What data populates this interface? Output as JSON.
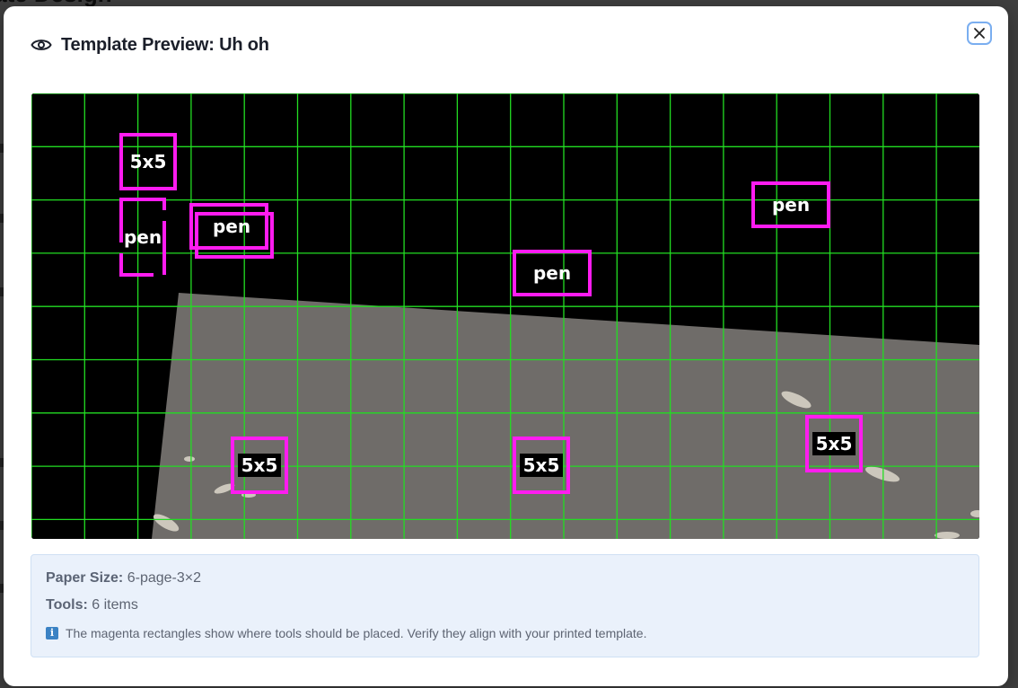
{
  "background": {
    "heading": "plate Design"
  },
  "modal": {
    "title": "Template Preview: Uh oh",
    "close_label": "×"
  },
  "preview": {
    "tools": [
      {
        "label": "5x5"
      },
      {
        "label": "pen"
      },
      {
        "label": "pen"
      },
      {
        "label": "pen"
      },
      {
        "label": "pen"
      },
      {
        "label": "5x5"
      },
      {
        "label": "5x5"
      },
      {
        "label": "5x5"
      }
    ],
    "colors": {
      "grid": "#22dd22",
      "tool_box": "#ff1cf0",
      "paper": "#6f6c69"
    }
  },
  "info": {
    "paper_size_key": "Paper Size:",
    "paper_size_value": "6-page-3×2",
    "tools_key": "Tools:",
    "tools_value": "6 items",
    "note_icon": "i",
    "note": "The magenta rectangles show where tools should be placed. Verify they align with your printed template."
  }
}
